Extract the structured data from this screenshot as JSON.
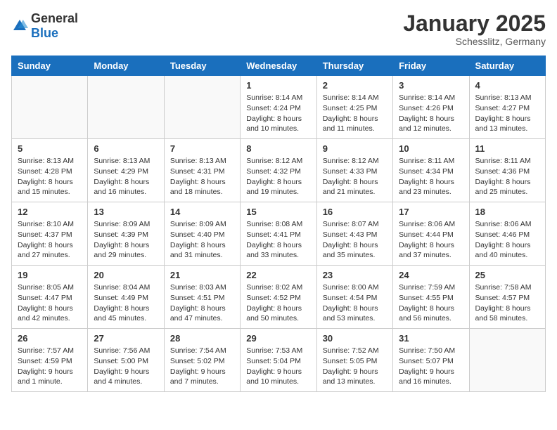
{
  "header": {
    "logo_general": "General",
    "logo_blue": "Blue",
    "title": "January 2025",
    "subtitle": "Schesslitz, Germany"
  },
  "days": [
    "Sunday",
    "Monday",
    "Tuesday",
    "Wednesday",
    "Thursday",
    "Friday",
    "Saturday"
  ],
  "weeks": [
    [
      {
        "date": "",
        "info": ""
      },
      {
        "date": "",
        "info": ""
      },
      {
        "date": "",
        "info": ""
      },
      {
        "date": "1",
        "info": "Sunrise: 8:14 AM\nSunset: 4:24 PM\nDaylight: 8 hours\nand 10 minutes."
      },
      {
        "date": "2",
        "info": "Sunrise: 8:14 AM\nSunset: 4:25 PM\nDaylight: 8 hours\nand 11 minutes."
      },
      {
        "date": "3",
        "info": "Sunrise: 8:14 AM\nSunset: 4:26 PM\nDaylight: 8 hours\nand 12 minutes."
      },
      {
        "date": "4",
        "info": "Sunrise: 8:13 AM\nSunset: 4:27 PM\nDaylight: 8 hours\nand 13 minutes."
      }
    ],
    [
      {
        "date": "5",
        "info": "Sunrise: 8:13 AM\nSunset: 4:28 PM\nDaylight: 8 hours\nand 15 minutes."
      },
      {
        "date": "6",
        "info": "Sunrise: 8:13 AM\nSunset: 4:29 PM\nDaylight: 8 hours\nand 16 minutes."
      },
      {
        "date": "7",
        "info": "Sunrise: 8:13 AM\nSunset: 4:31 PM\nDaylight: 8 hours\nand 18 minutes."
      },
      {
        "date": "8",
        "info": "Sunrise: 8:12 AM\nSunset: 4:32 PM\nDaylight: 8 hours\nand 19 minutes."
      },
      {
        "date": "9",
        "info": "Sunrise: 8:12 AM\nSunset: 4:33 PM\nDaylight: 8 hours\nand 21 minutes."
      },
      {
        "date": "10",
        "info": "Sunrise: 8:11 AM\nSunset: 4:34 PM\nDaylight: 8 hours\nand 23 minutes."
      },
      {
        "date": "11",
        "info": "Sunrise: 8:11 AM\nSunset: 4:36 PM\nDaylight: 8 hours\nand 25 minutes."
      }
    ],
    [
      {
        "date": "12",
        "info": "Sunrise: 8:10 AM\nSunset: 4:37 PM\nDaylight: 8 hours\nand 27 minutes."
      },
      {
        "date": "13",
        "info": "Sunrise: 8:09 AM\nSunset: 4:39 PM\nDaylight: 8 hours\nand 29 minutes."
      },
      {
        "date": "14",
        "info": "Sunrise: 8:09 AM\nSunset: 4:40 PM\nDaylight: 8 hours\nand 31 minutes."
      },
      {
        "date": "15",
        "info": "Sunrise: 8:08 AM\nSunset: 4:41 PM\nDaylight: 8 hours\nand 33 minutes."
      },
      {
        "date": "16",
        "info": "Sunrise: 8:07 AM\nSunset: 4:43 PM\nDaylight: 8 hours\nand 35 minutes."
      },
      {
        "date": "17",
        "info": "Sunrise: 8:06 AM\nSunset: 4:44 PM\nDaylight: 8 hours\nand 37 minutes."
      },
      {
        "date": "18",
        "info": "Sunrise: 8:06 AM\nSunset: 4:46 PM\nDaylight: 8 hours\nand 40 minutes."
      }
    ],
    [
      {
        "date": "19",
        "info": "Sunrise: 8:05 AM\nSunset: 4:47 PM\nDaylight: 8 hours\nand 42 minutes."
      },
      {
        "date": "20",
        "info": "Sunrise: 8:04 AM\nSunset: 4:49 PM\nDaylight: 8 hours\nand 45 minutes."
      },
      {
        "date": "21",
        "info": "Sunrise: 8:03 AM\nSunset: 4:51 PM\nDaylight: 8 hours\nand 47 minutes."
      },
      {
        "date": "22",
        "info": "Sunrise: 8:02 AM\nSunset: 4:52 PM\nDaylight: 8 hours\nand 50 minutes."
      },
      {
        "date": "23",
        "info": "Sunrise: 8:00 AM\nSunset: 4:54 PM\nDaylight: 8 hours\nand 53 minutes."
      },
      {
        "date": "24",
        "info": "Sunrise: 7:59 AM\nSunset: 4:55 PM\nDaylight: 8 hours\nand 56 minutes."
      },
      {
        "date": "25",
        "info": "Sunrise: 7:58 AM\nSunset: 4:57 PM\nDaylight: 8 hours\nand 58 minutes."
      }
    ],
    [
      {
        "date": "26",
        "info": "Sunrise: 7:57 AM\nSunset: 4:59 PM\nDaylight: 9 hours\nand 1 minute."
      },
      {
        "date": "27",
        "info": "Sunrise: 7:56 AM\nSunset: 5:00 PM\nDaylight: 9 hours\nand 4 minutes."
      },
      {
        "date": "28",
        "info": "Sunrise: 7:54 AM\nSunset: 5:02 PM\nDaylight: 9 hours\nand 7 minutes."
      },
      {
        "date": "29",
        "info": "Sunrise: 7:53 AM\nSunset: 5:04 PM\nDaylight: 9 hours\nand 10 minutes."
      },
      {
        "date": "30",
        "info": "Sunrise: 7:52 AM\nSunset: 5:05 PM\nDaylight: 9 hours\nand 13 minutes."
      },
      {
        "date": "31",
        "info": "Sunrise: 7:50 AM\nSunset: 5:07 PM\nDaylight: 9 hours\nand 16 minutes."
      },
      {
        "date": "",
        "info": ""
      }
    ]
  ]
}
